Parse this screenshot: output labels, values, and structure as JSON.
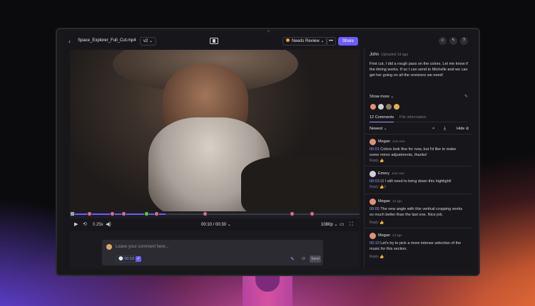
{
  "toolbar": {
    "back_icon": "chevron-left-icon",
    "file_name": "Space_Explorer_Full_Cut.mp4",
    "version": "v2 ⌄",
    "status": "Needs Review ⌄",
    "more": "•••",
    "share": "Share",
    "accent": "#6c5cff"
  },
  "player": {
    "time": "00:10 / 00:30 ⌄",
    "speed": "0.25x",
    "resolution": "1080p ⌄",
    "progress": 0.33
  },
  "composer": {
    "placeholder": "Leave your comment here...",
    "timestamp": "🕓 00:10",
    "send": "Send"
  },
  "panel": {
    "author": "John",
    "uploaded": "Uploaded 1d ago",
    "description": "First cut, I did a rough pass on the colors. Let me know if the timing works. If so I can send to Michelle and we can get her going on all the revisions we need!",
    "show_more": "Show more ⌄",
    "tabs": [
      "12 Comments",
      "File information"
    ],
    "sort": "Newest ⌄",
    "hide": "Hide"
  },
  "comments": [
    {
      "name": "Megan",
      "time": "Just now",
      "stamp": "00:01",
      "text": " Colors look fine for now, but I'd like to make some minor adjustments, thanks!",
      "reply": "Reply",
      "likes": ""
    },
    {
      "name": "Emery",
      "time": "Just now",
      "stamp": "00:03",
      "text": " ☑ I still need to bring down this highlight!",
      "reply": "Reply",
      "likes": "2"
    },
    {
      "name": "Megan",
      "time": "1d ago",
      "stamp": "00:05",
      "text": " The new angle with this vertical cropping works so much better than the last one. Nice job.",
      "reply": "Reply",
      "likes": ""
    },
    {
      "name": "Megan",
      "time": "1d ago",
      "stamp": "00:10",
      "text": " Let's try to pick a more intense selection of the music for this section.",
      "reply": "Reply",
      "likes": ""
    }
  ]
}
